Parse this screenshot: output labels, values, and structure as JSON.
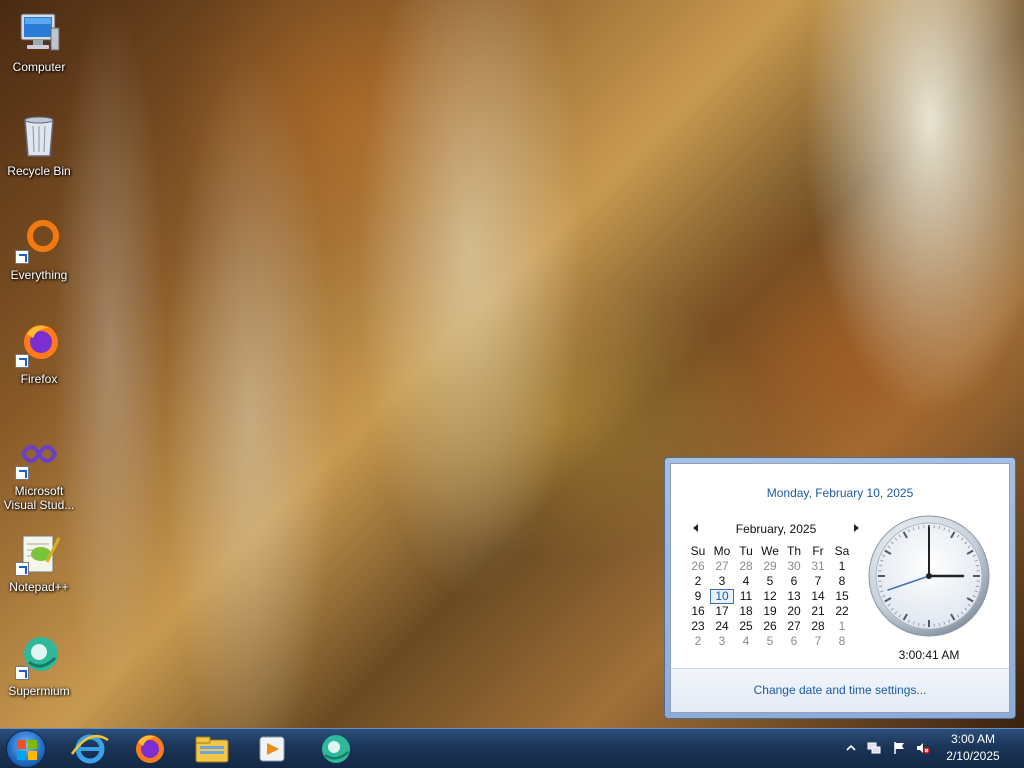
{
  "desktop": {
    "icons": [
      {
        "label": "Computer",
        "icon": "computer-icon"
      },
      {
        "label": "Recycle Bin",
        "icon": "recycle-bin-icon"
      },
      {
        "label": "Everything",
        "icon": "everything-icon"
      },
      {
        "label": "Firefox",
        "icon": "firefox-icon"
      },
      {
        "label": "Microsoft Visual Stud...",
        "icon": "visual-studio-icon"
      },
      {
        "label": "Notepad++",
        "icon": "notepad-plus-plus-icon"
      },
      {
        "label": "Supermium",
        "icon": "supermium-icon"
      }
    ]
  },
  "flyout": {
    "date_header": "Monday, February 10, 2025",
    "month_label": "February, 2025",
    "weekday_headers": [
      "Su",
      "Mo",
      "Tu",
      "We",
      "Th",
      "Fr",
      "Sa"
    ],
    "weeks": [
      [
        {
          "d": "26",
          "o": true
        },
        {
          "d": "27",
          "o": true
        },
        {
          "d": "28",
          "o": true
        },
        {
          "d": "29",
          "o": true
        },
        {
          "d": "30",
          "o": true
        },
        {
          "d": "31",
          "o": true
        },
        {
          "d": "1",
          "o": false
        }
      ],
      [
        {
          "d": "2",
          "o": false
        },
        {
          "d": "3",
          "o": false
        },
        {
          "d": "4",
          "o": false
        },
        {
          "d": "5",
          "o": false
        },
        {
          "d": "6",
          "o": false
        },
        {
          "d": "7",
          "o": false
        },
        {
          "d": "8",
          "o": false
        }
      ],
      [
        {
          "d": "9",
          "o": false
        },
        {
          "d": "10",
          "o": false,
          "today": true
        },
        {
          "d": "11",
          "o": false
        },
        {
          "d": "12",
          "o": false
        },
        {
          "d": "13",
          "o": false
        },
        {
          "d": "14",
          "o": false
        },
        {
          "d": "15",
          "o": false
        }
      ],
      [
        {
          "d": "16",
          "o": false
        },
        {
          "d": "17",
          "o": false
        },
        {
          "d": "18",
          "o": false
        },
        {
          "d": "19",
          "o": false
        },
        {
          "d": "20",
          "o": false
        },
        {
          "d": "21",
          "o": false
        },
        {
          "d": "22",
          "o": false
        }
      ],
      [
        {
          "d": "23",
          "o": false
        },
        {
          "d": "24",
          "o": false
        },
        {
          "d": "25",
          "o": false
        },
        {
          "d": "26",
          "o": false
        },
        {
          "d": "27",
          "o": false
        },
        {
          "d": "28",
          "o": false
        },
        {
          "d": "1",
          "o": true
        }
      ],
      [
        {
          "d": "2",
          "o": true
        },
        {
          "d": "3",
          "o": true
        },
        {
          "d": "4",
          "o": true
        },
        {
          "d": "5",
          "o": true
        },
        {
          "d": "6",
          "o": true
        },
        {
          "d": "7",
          "o": true
        },
        {
          "d": "8",
          "o": true
        }
      ]
    ],
    "time_label": "3:00:41 AM",
    "settings_link": "Change date and time settings..."
  },
  "taskbar": {
    "pinned": [
      {
        "icon": "internet-explorer-icon"
      },
      {
        "icon": "firefox-icon"
      },
      {
        "icon": "file-explorer-icon"
      },
      {
        "icon": "media-player-icon"
      },
      {
        "icon": "supermium-icon"
      }
    ],
    "tray": {
      "icons": [
        "show-hidden-icons-chevron-icon",
        "network-icon",
        "action-center-flag-icon",
        "volume-muted-icon"
      ]
    },
    "clock": {
      "time": "3:00 AM",
      "date": "2/10/2025"
    }
  },
  "colors": {
    "link_blue": "#1e5aa8",
    "taskbar_top": "#2c4f7c",
    "taskbar_bottom": "#132845"
  }
}
